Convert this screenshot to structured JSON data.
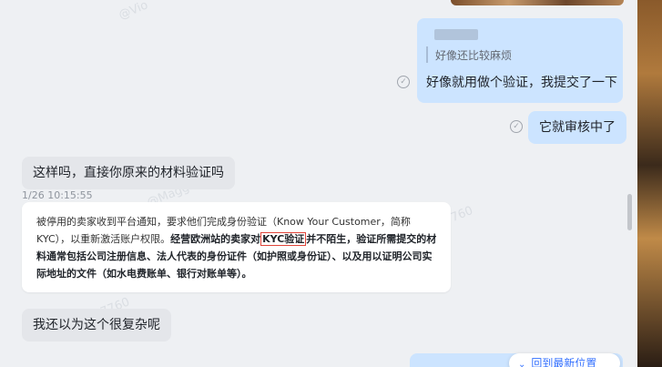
{
  "watermarks": [
    "@Vio",
    "@Maggie",
    "760",
    "7760",
    "Vio"
  ],
  "messages": {
    "quote_text": "好像还比较麻烦",
    "msg1": "好像就用做个验证，我提交了一下",
    "msg2": "它就审核中了",
    "msg3": "这样吗，直接你原来的材料验证吗",
    "timestamp": "1/26 10:15:55",
    "msg5": "我还以为这个很复杂呢"
  },
  "card": {
    "part1": "被停用的卖家收到平台通知，要求他们完成身份验证（Know Your Customer，简称KYC），以重新激活账户权限。",
    "bold_pre": "经营欧洲站的卖家对",
    "bold_kyc": "KYC验证",
    "bold_post": "并不陌生",
    "part2": "，验证所需提交的材料通常包括公司注册信息、法人代表的身份证件（如护照或身份证）、以及用以证明公司实际地址的文件（如水电费账单、银行对账单等）。"
  },
  "jump": {
    "chevron": "⌄",
    "label": "回到最新位置"
  },
  "icons": {
    "read": "read-receipt-icon"
  }
}
